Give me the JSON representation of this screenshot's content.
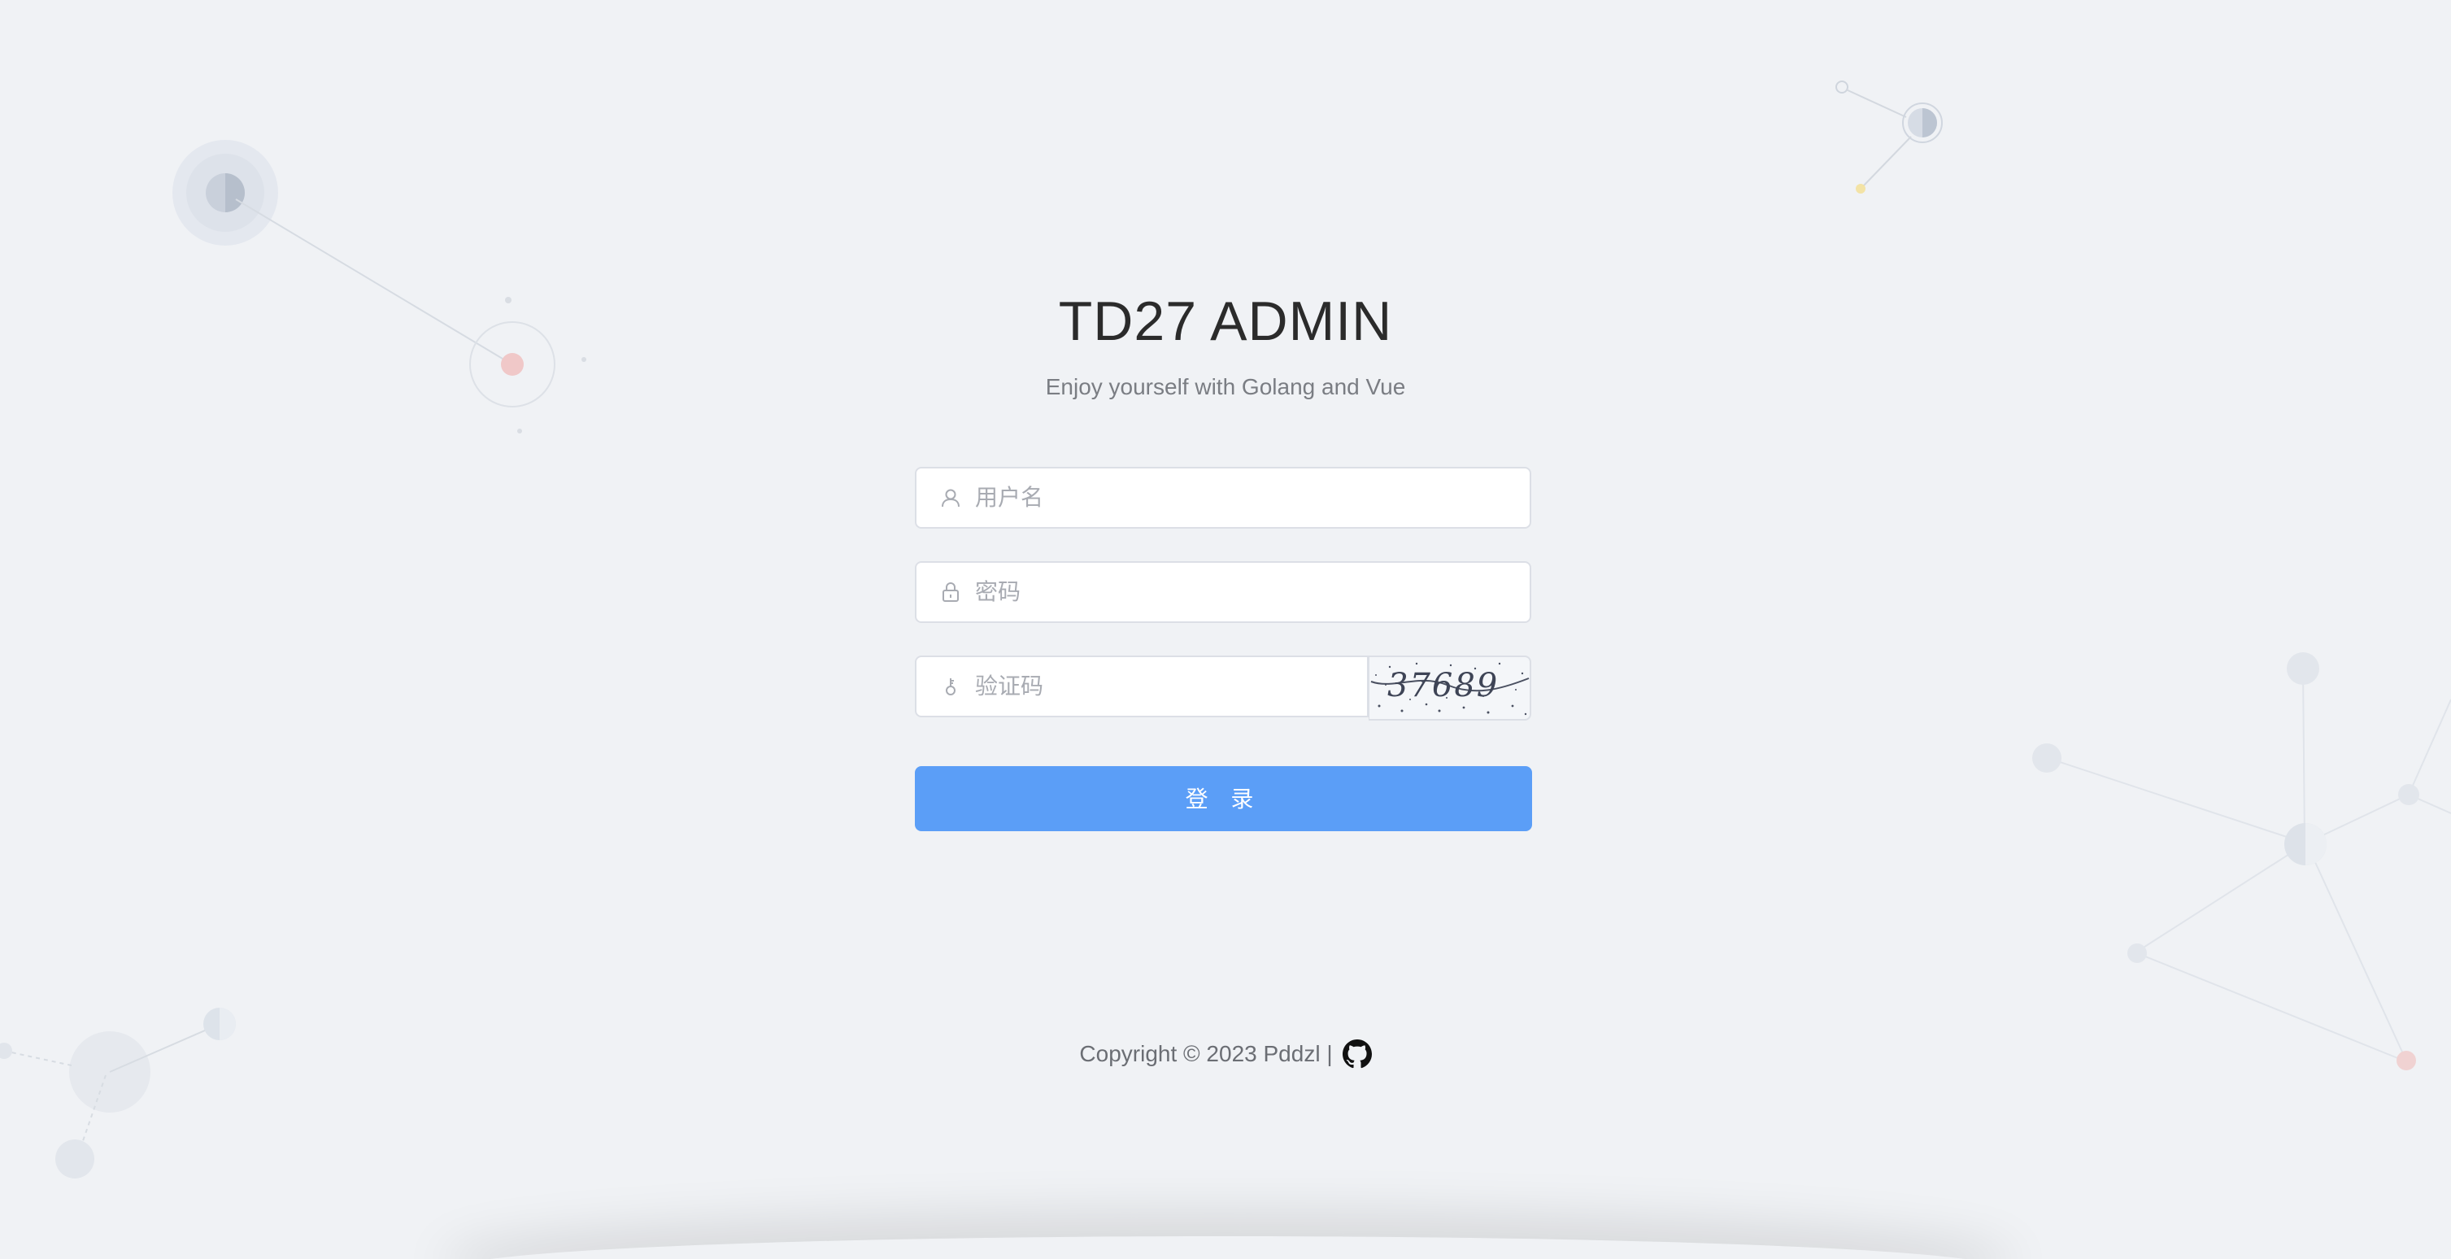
{
  "app": {
    "title": "TD27 ADMIN",
    "subtitle": "Enjoy yourself with Golang and Vue"
  },
  "form": {
    "username": {
      "placeholder": "用户名",
      "value": "",
      "icon": "user-icon"
    },
    "password": {
      "placeholder": "密码",
      "value": "",
      "icon": "lock-icon"
    },
    "captcha": {
      "placeholder": "验证码",
      "value": "",
      "icon": "key-icon",
      "image_text": "37689"
    },
    "submit_label": "登 录"
  },
  "footer": {
    "copyright": "Copyright © 2023 Pddzl |",
    "link_icon": "github-icon"
  },
  "colors": {
    "background": "#f0f2f5",
    "primary": "#5b9ef7",
    "title": "#2b2b2b",
    "muted": "#7a7d83",
    "border": "#dcdfe6"
  }
}
